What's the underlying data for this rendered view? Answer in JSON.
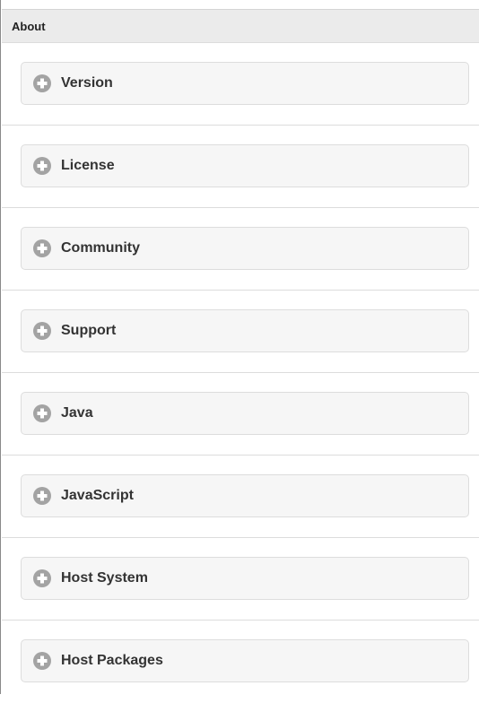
{
  "header": {
    "title": "About"
  },
  "sections": [
    {
      "label": "Version",
      "icon": "plus-circle-icon"
    },
    {
      "label": "License",
      "icon": "plus-circle-icon"
    },
    {
      "label": "Community",
      "icon": "plus-circle-icon"
    },
    {
      "label": "Support",
      "icon": "plus-circle-icon"
    },
    {
      "label": "Java",
      "icon": "plus-circle-icon"
    },
    {
      "label": "JavaScript",
      "icon": "plus-circle-icon"
    },
    {
      "label": "Host System",
      "icon": "plus-circle-icon"
    },
    {
      "label": "Host Packages",
      "icon": "plus-circle-icon"
    }
  ],
  "colors": {
    "header_bg": "#ebebeb",
    "collapsible_bg": "#f6f6f6",
    "icon_bg": "#a3a3a3"
  }
}
